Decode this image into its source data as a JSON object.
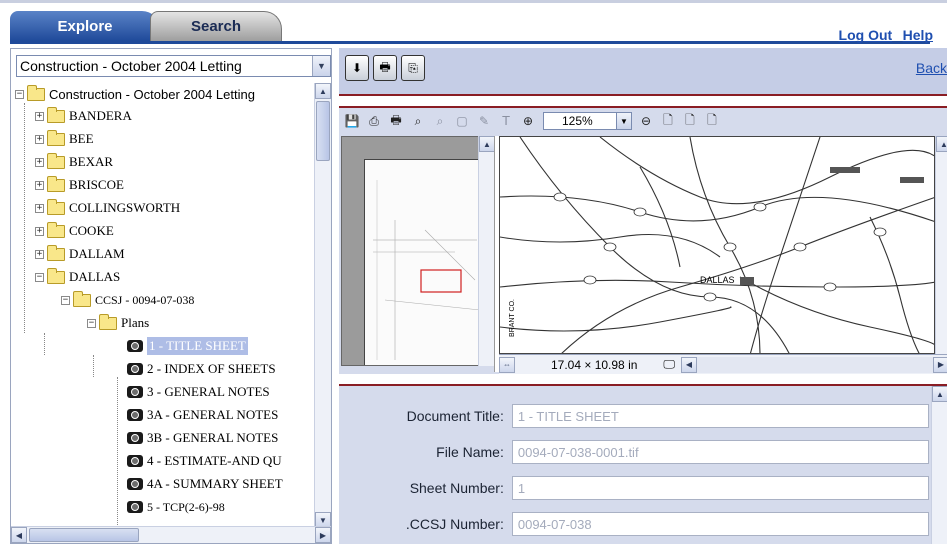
{
  "tabs": {
    "explore": "Explore",
    "search": "Search"
  },
  "top_links": {
    "logout": "Log Out",
    "help": "Help"
  },
  "back_link": "Back",
  "combo": {
    "selected": "Construction - October 2004 Letting"
  },
  "tree": {
    "root": "Construction - October 2004 Letting",
    "counties": [
      "BANDERA",
      "BEE",
      "BEXAR",
      "BRISCOE",
      "COLLINGSWORTH",
      "COOKE",
      "DALLAM",
      "DALLAS"
    ],
    "ccsj": "CCSJ - 0094-07-038",
    "plans": "Plans",
    "sheets": [
      "1 - TITLE SHEET",
      "2 - INDEX OF SHEETS",
      "3 - GENERAL NOTES",
      "3A - GENERAL NOTES",
      "3B - GENERAL NOTES",
      "4 - ESTIMATE-AND QU",
      "4A - SUMMARY SHEET",
      "5 - TCP(2-6)-98"
    ],
    "selected_index": 0
  },
  "viewer": {
    "zoom": "125%",
    "page_size": "17.04 × 10.98 in",
    "map_labels": [
      "DALLAS",
      "BRANT CO."
    ]
  },
  "properties": {
    "rows": [
      {
        "label": "Document Title:",
        "value": "1 - TITLE SHEET"
      },
      {
        "label": "File Name:",
        "value": "0094-07-038-0001.tif"
      },
      {
        "label": "Sheet Number:",
        "value": "1"
      },
      {
        "label": ".CCSJ Number:",
        "value": "0094-07-038"
      }
    ]
  },
  "icons": {
    "tree_expander": "plus-box-icon",
    "folder": "folder-icon",
    "sheet": "camera-icon"
  },
  "colors": {
    "accent_blue": "#1f4a9a",
    "link_blue": "#1f4fb0",
    "panel_bg": "#d5dbec",
    "divider_red": "#8a1d24"
  }
}
